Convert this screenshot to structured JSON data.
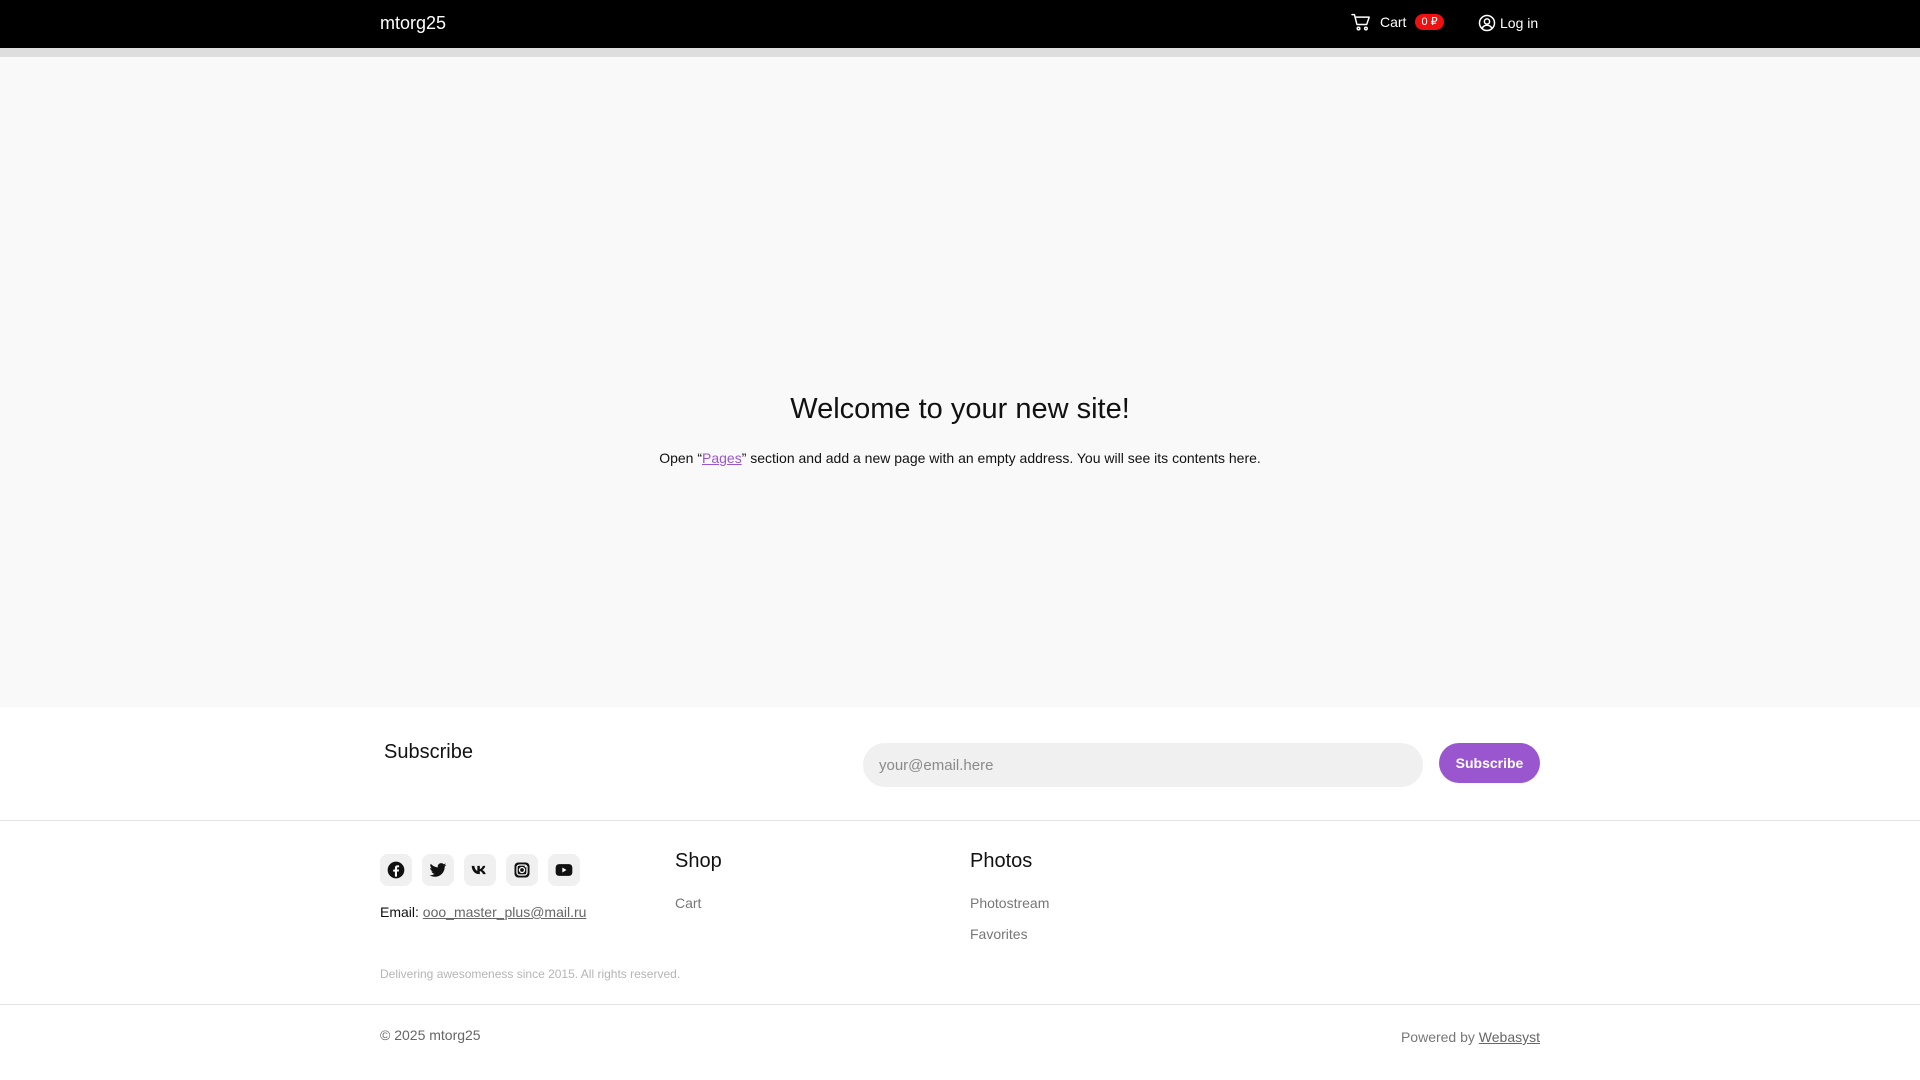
{
  "header": {
    "brand": "mtorg25",
    "cart": {
      "label": "Cart",
      "badge": "0 ₽",
      "icon": "cart-icon"
    },
    "login": {
      "label": "Log in",
      "icon": "user-circle-icon"
    }
  },
  "main": {
    "title": "Welcome to your new site!",
    "text_before": "Open “",
    "pages_link": "Pages",
    "text_after": "” section and add a new page with an empty address. You will see its contents here."
  },
  "subscribe": {
    "title": "Subscribe",
    "placeholder": "your@email.here",
    "button": "Subscribe"
  },
  "footer": {
    "social": [
      "facebook-icon",
      "twitter-icon",
      "vk-icon",
      "instagram-icon",
      "youtube-icon"
    ],
    "email_label": "Email:",
    "email": "ooo_master_plus@mail.ru",
    "tagline": "Delivering awesomeness since 2015. All rights reserved.",
    "shop": {
      "title": "Shop",
      "links": [
        "Cart"
      ]
    },
    "photos": {
      "title": "Photos",
      "links": [
        "Photostream",
        "Favorites"
      ]
    }
  },
  "bottom": {
    "copyright": "© 2025 mtorg25",
    "powered_label": "Powered by",
    "powered_link": "Webasyst"
  },
  "colors": {
    "accent": "#9a56cf",
    "badge": "#e11111",
    "header_bg": "#000000",
    "main_bg": "#f9f9f9"
  }
}
